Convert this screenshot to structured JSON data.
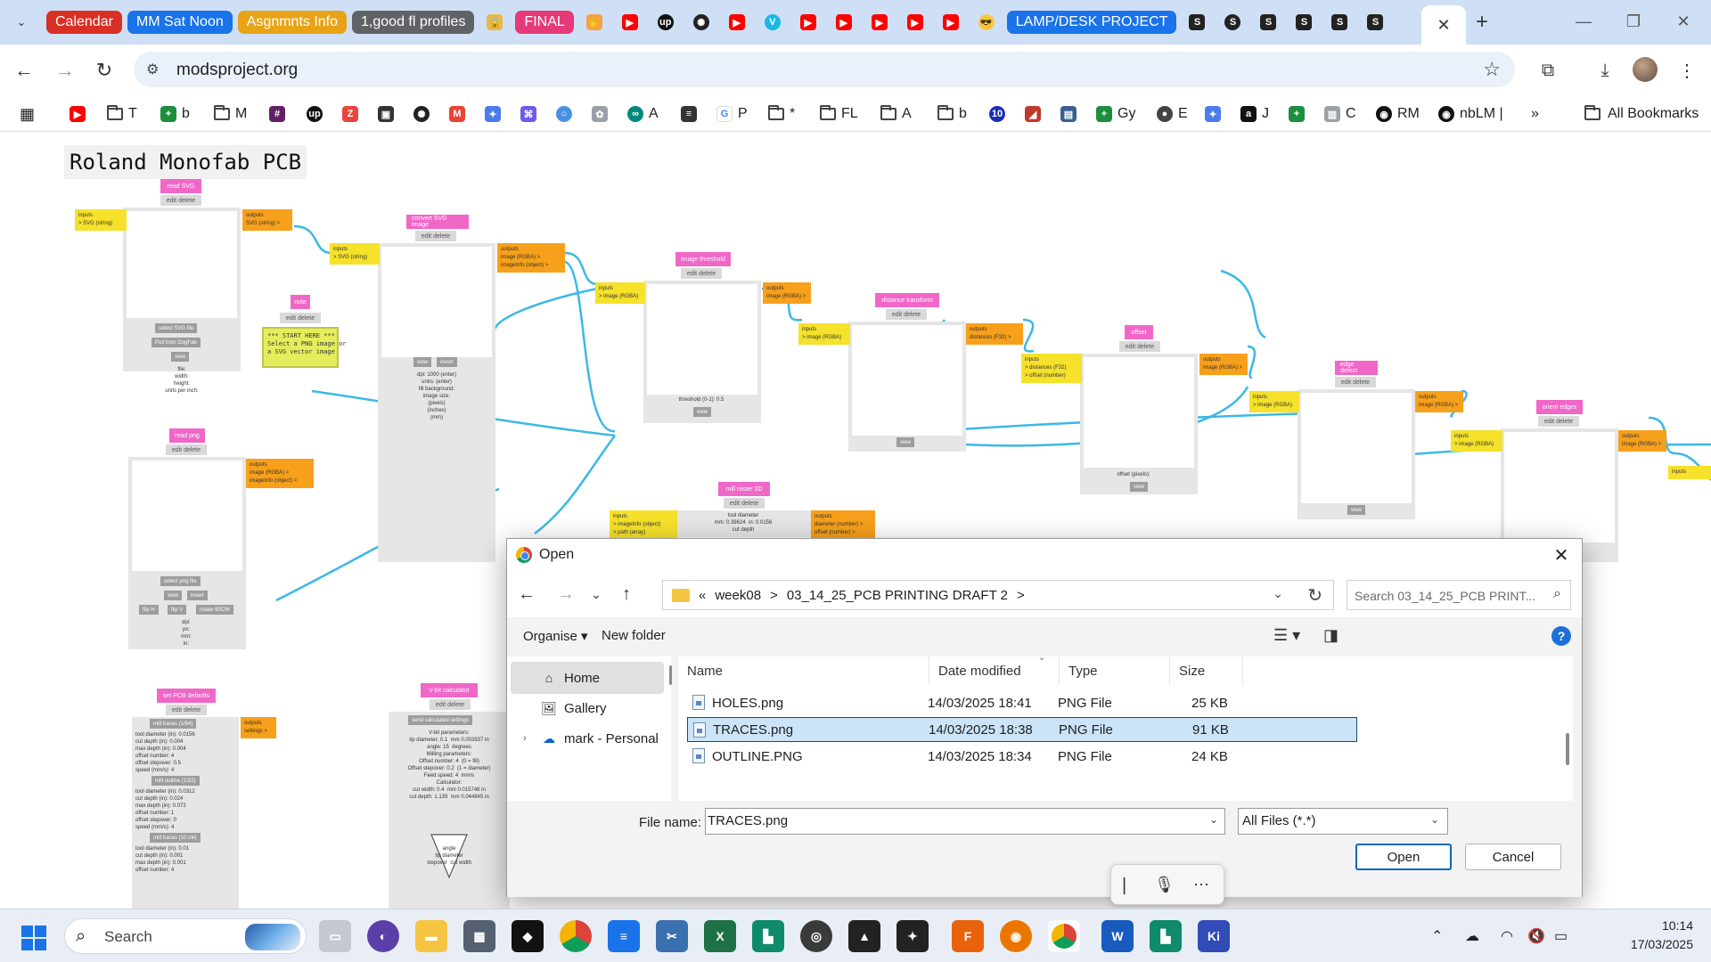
{
  "browser": {
    "tab_groups": [
      {
        "label": "Calendar",
        "color": "#d93025"
      },
      {
        "label": "MM Sat Noon",
        "color": "#1a73e8"
      },
      {
        "label": "Asgnmnts Info",
        "color": "#e8a317"
      },
      {
        "label": "1,good fl profiles",
        "color": "#5f6368"
      },
      {
        "label": "FINAL",
        "color": "#e53978"
      },
      {
        "label": "LAMP/DESK PROJECT",
        "color": "#1a73e8"
      }
    ],
    "url": "modsproject.org",
    "bookmarks": [
      "T",
      "b",
      "M",
      "G",
      "P",
      "*",
      "FL",
      "A",
      "b",
      "Gy",
      "E",
      "J",
      "C",
      "RM",
      "nbLM |"
    ],
    "all_bookmarks_label": "All Bookmarks",
    "bookmark_badge": "10"
  },
  "page": {
    "title": "Roland Monofab PCB",
    "modules": {
      "read_svg": {
        "label": "read SVG",
        "btns": "edit delete",
        "in": "inputs\n> SVG (string)",
        "out": "outputs\nSVG (string) >",
        "b1": "select SVG file",
        "b2": "Pull from DogFab",
        "b3": "view",
        "info": "file:\nwidth:\nheight:\nunits per inch:"
      },
      "convert_svg": {
        "label": "convert SVG image",
        "btns": "edit delete",
        "in": "inputs\n> SVG (string)",
        "out": "outputs\nimage (RGBA) >\nimageInfo (object) >",
        "b1": "view",
        "b2": "invert",
        "info": "dpi: 1000 (enter)\nunits: (enter)\nfill background:\nimage size:\n(pixels)\n(inches)\n(mm)"
      },
      "note": {
        "label": "note",
        "btns": "edit delete",
        "text": "*** START HERE ***\nSelect a PNG image or\na SVG vector image"
      },
      "read_png": {
        "label": "read png",
        "btns": "edit delete",
        "out": "outputs\nimage (RGBA) >\nimageInfo (object) >",
        "b1": "select png file",
        "b2": "view",
        "b3": "invert",
        "b4": "flip H",
        "b5": "flip V",
        "b6": "rotate 90CW",
        "info": "dpi:\npx:\nmm:\nin:"
      },
      "image_threshold": {
        "label": "image threshold",
        "btns": "edit delete",
        "in": "inputs\n> image (RGBA)",
        "out": "outputs\nimage (RGBA) >",
        "info": "threshold (0-1): 0.5",
        "b1": "view"
      },
      "distance_transform": {
        "label": "distance transform",
        "btns": "edit delete",
        "in": "inputs\n> image (RGBA)",
        "out": "outputs\ndistances (F32) >",
        "b1": "view"
      },
      "offset": {
        "label": "offset",
        "btns": "edit delete",
        "in": "inputs\n> distances (F32)\n> offset (number)",
        "out": "outputs\nimage (RGBA) >",
        "info": "offset (pixels):",
        "b1": "view"
      },
      "edge_detect": {
        "label": "edge detect",
        "btns": "edit delete",
        "in": "inputs\n> image (RGBA)",
        "out": "outputs\nimage (RGBA) >",
        "b1": "view"
      },
      "orient_edges": {
        "label": "orient edges",
        "btns": "edit delete",
        "in": "inputs\n> image (RGBA)",
        "out": "outputs\nimage (RGBA) >"
      },
      "mill_raster": {
        "label": "mill raster 2D",
        "btns": "edit delete",
        "in": "inputs\n> imageInfo (object)\n> path (array)",
        "out": "outputs\ndiameter (number) >\noffset (number) >",
        "info": "tool diameter\nmm: 0.39624  in: 0.0156\ncut depth"
      },
      "set_pcb": {
        "label": "set PCB defaults",
        "btns": "edit delete",
        "out": "outputs\nsettings >",
        "sec1": "mill traces (1/64)",
        "sec2": "mill outline (1/32)",
        "sec3": "mill traces (10 mil)",
        "f1": "tool diameter (in): 0.0156\ncut depth (in): 0.004\nmax depth (in): 0.004\noffset number: 4\noffset stepover: 0.5\nspeed (mm/s): 4",
        "f2": "tool diameter (in): 0.0312\ncut depth (in): 0.024\nmax depth (in): 0.072\noffset number: 1\noffset stepover: 0\nspeed (mm/s): 4",
        "f3": "tool diameter (in): 0.01\ncut depth (in): 0.001\nmax depth (in): 0.001\noffset number: 4"
      },
      "vbit": {
        "label": "V-bit calculator",
        "btns": "edit delete",
        "b1": "send calculated settings",
        "info": "V-bit parameters:\ntip diameter: 0.1  mm 0.003937 in\nangle: 15  degrees\nMilling parameters:\nOffset number: 4  (0 = fill)\nOffset stepover: 0.2  (1 = diameter)\nFeed speed: 4  mm/s\nCalculator:\ncut width: 0.4  mm 0.015748 in\ncut depth: 1.139  mm 0.044845 in",
        "tip": "angle\ntip diameter\nstepover  cut width"
      }
    }
  },
  "dialog": {
    "title": "Open",
    "breadcrumb": [
      "«",
      "week08",
      ">",
      "03_14_25_PCB PRINTING DRAFT 2",
      ">"
    ],
    "search_placeholder": "Search 03_14_25_PCB PRINT...",
    "organise": "Organise ▾",
    "new_folder": "New folder",
    "nav": [
      "Home",
      "Gallery",
      "mark - Personal"
    ],
    "columns": [
      "Name",
      "Date modified",
      "Type",
      "Size"
    ],
    "files": [
      {
        "name": "HOLES.png",
        "date": "14/03/2025 18:41",
        "type": "PNG File",
        "size": "25 KB"
      },
      {
        "name": "TRACES.png",
        "date": "14/03/2025 18:38",
        "type": "PNG File",
        "size": "91 KB",
        "selected": true
      },
      {
        "name": "OUTLINE.PNG",
        "date": "14/03/2025 18:34",
        "type": "PNG File",
        "size": "24 KB"
      }
    ],
    "file_name_label": "File name:",
    "file_name_value": "TRACES.png",
    "file_type_value": "All Files (*.*)",
    "open_label": "Open",
    "cancel_label": "Cancel"
  },
  "taskbar": {
    "search_label": "Search",
    "time": "10:14",
    "date": "17/03/2025"
  },
  "colors": {
    "module_label": "#f067c8",
    "input_port": "#f6e12b",
    "output_port": "#f7a01b",
    "wire": "#3cb8e6",
    "accent": "#0067c0"
  }
}
